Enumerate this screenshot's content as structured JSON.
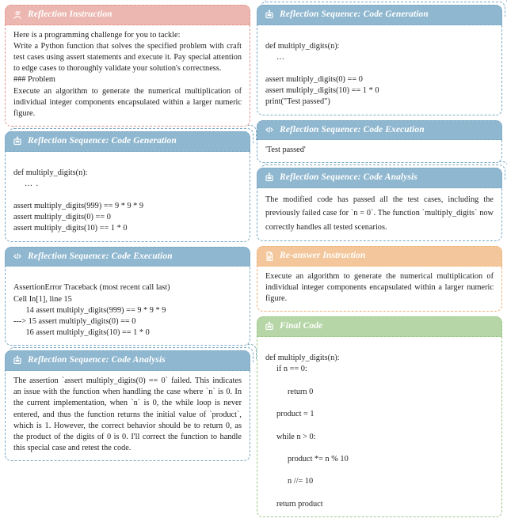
{
  "left": {
    "card1": {
      "title": "Reflection Instruction",
      "body_p1": "Here is a programming challenge for you to tackle:",
      "body_p2": "Write a Python function that solves the specified problem with craft test cases using assert statements and execute it. Pay special attention to edge cases to thoroughly validate your solution's correctness.",
      "body_h": "### Problem",
      "body_p3": "Execute an algorithm to generate the numerical multiplication of individual integer components encapsulated within a larger numeric figure."
    },
    "card2": {
      "title": "Reflection Sequence: Code Generation",
      "l1": "def multiply_digits(n):",
      "l2": "… .",
      "l3": "assert multiply_digits(999) == 9 * 9 * 9",
      "l4": "assert multiply_digits(0) == 0",
      "l5": "assert multiply_digits(10) == 1 * 0"
    },
    "card3": {
      "title": "Reflection Sequence: Code Execution",
      "l1": "AssertionError Traceback (most recent call last)",
      "l2": "Cell In[1], line 15",
      "l3": "      14 assert multiply_digits(999) == 9 * 9 * 9",
      "l4": "---> 15 assert multiply_digits(0) == 0",
      "l5": "      16 assert multiply_digits(10) == 1 * 0"
    },
    "card4": {
      "title": "Reflection Sequence: Code Analysis",
      "body": "The assertion `assert multiply_digits(0) == 0` failed. This indicates an issue with the function when handling the case where `n` is 0. In the current implementation, when `n` is 0, the while loop is never entered, and thus the function returns the initial value of `product`, which is 1. However, the correct behavior should be to return 0, as the product of the digits of 0 is 0. I'll correct the function to handle this special case and retest the code."
    }
  },
  "right": {
    "card1": {
      "title": "Reflection Sequence: Code Generation",
      "l1": "def multiply_digits(n):",
      "l2": "…",
      "l3": "assert multiply_digits(0) == 0",
      "l4": "assert multiply_digits(10) == 1 * 0",
      "l5": "print(\"Test passed\")"
    },
    "card2": {
      "title": "Reflection Sequence: Code Execution",
      "body": "'Test passed'"
    },
    "card3": {
      "title": "Reflection Sequence: Code Analysis",
      "body": "The modified code has passed all the test cases, including the previously failed case for `n = 0`. The function `multiply_digits` now correctly handles all tested scenarios."
    },
    "card4": {
      "title": "Re-answer Instruction",
      "body": "Execute an algorithm to generate the numerical multiplication of individual integer components encapsulated within a larger numeric figure."
    },
    "card5": {
      "title": "Final Code",
      "l1": "def multiply_digits(n):",
      "l2": "if n == 0:",
      "l3": "return 0",
      "l4": "product = 1",
      "l5": "while n > 0:",
      "l6": "product *= n % 10",
      "l7": "n //= 10",
      "l8": "return product"
    }
  },
  "icons": {
    "person": "person-icon",
    "robot": "robot-icon",
    "code": "code-icon",
    "doc": "doc-icon"
  }
}
